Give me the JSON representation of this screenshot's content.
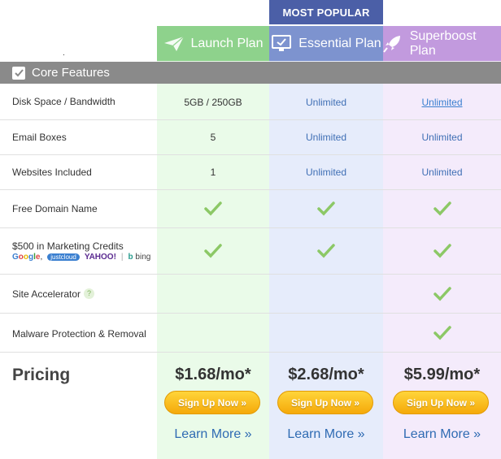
{
  "header": {
    "most_popular": "MOST POPULAR",
    "dot": ".",
    "plans": [
      {
        "name": "Launch Plan",
        "icon": "paper-plane-icon",
        "color": "#8ed28c"
      },
      {
        "name": "Essential Plan",
        "icon": "monitor-check-icon",
        "color": "#7d93cf"
      },
      {
        "name": "Superboost Plan",
        "icon": "rocket-icon",
        "color": "#c29ade"
      }
    ]
  },
  "core_features": {
    "label": "Core Features",
    "icon": "checkbox-icon"
  },
  "rows": [
    {
      "label": "Disk Space / Bandwidth",
      "launch": "5GB / 250GB",
      "essential": "Unlimited",
      "super": "Unlimited"
    },
    {
      "label": "Email Boxes",
      "launch": "5",
      "essential": "Unlimited",
      "super": "Unlimited"
    },
    {
      "label": "Websites Included",
      "launch": "1",
      "essential": "Unlimited",
      "super": "Unlimited"
    },
    {
      "label": "Free Domain Name"
    },
    {
      "label": "$500 in Marketing Credits"
    },
    {
      "label": "Site Accelerator",
      "help": "?"
    },
    {
      "label": "Malware Protection & Removal"
    }
  ],
  "marketing_logos": {
    "google": "Google",
    "justcloud": "justcloud",
    "yahoo": "YAHOO!",
    "bing": "bing"
  },
  "pricing": {
    "label": "Pricing",
    "launch": "$1.68/mo*",
    "essential": "$2.68/mo*",
    "super": "$5.99/mo*",
    "signup": "Sign Up Now »",
    "learn": "Learn More »"
  },
  "colors": {
    "check": "#8cc866",
    "signup": "#f5a90a",
    "link": "#2f6bb3"
  }
}
